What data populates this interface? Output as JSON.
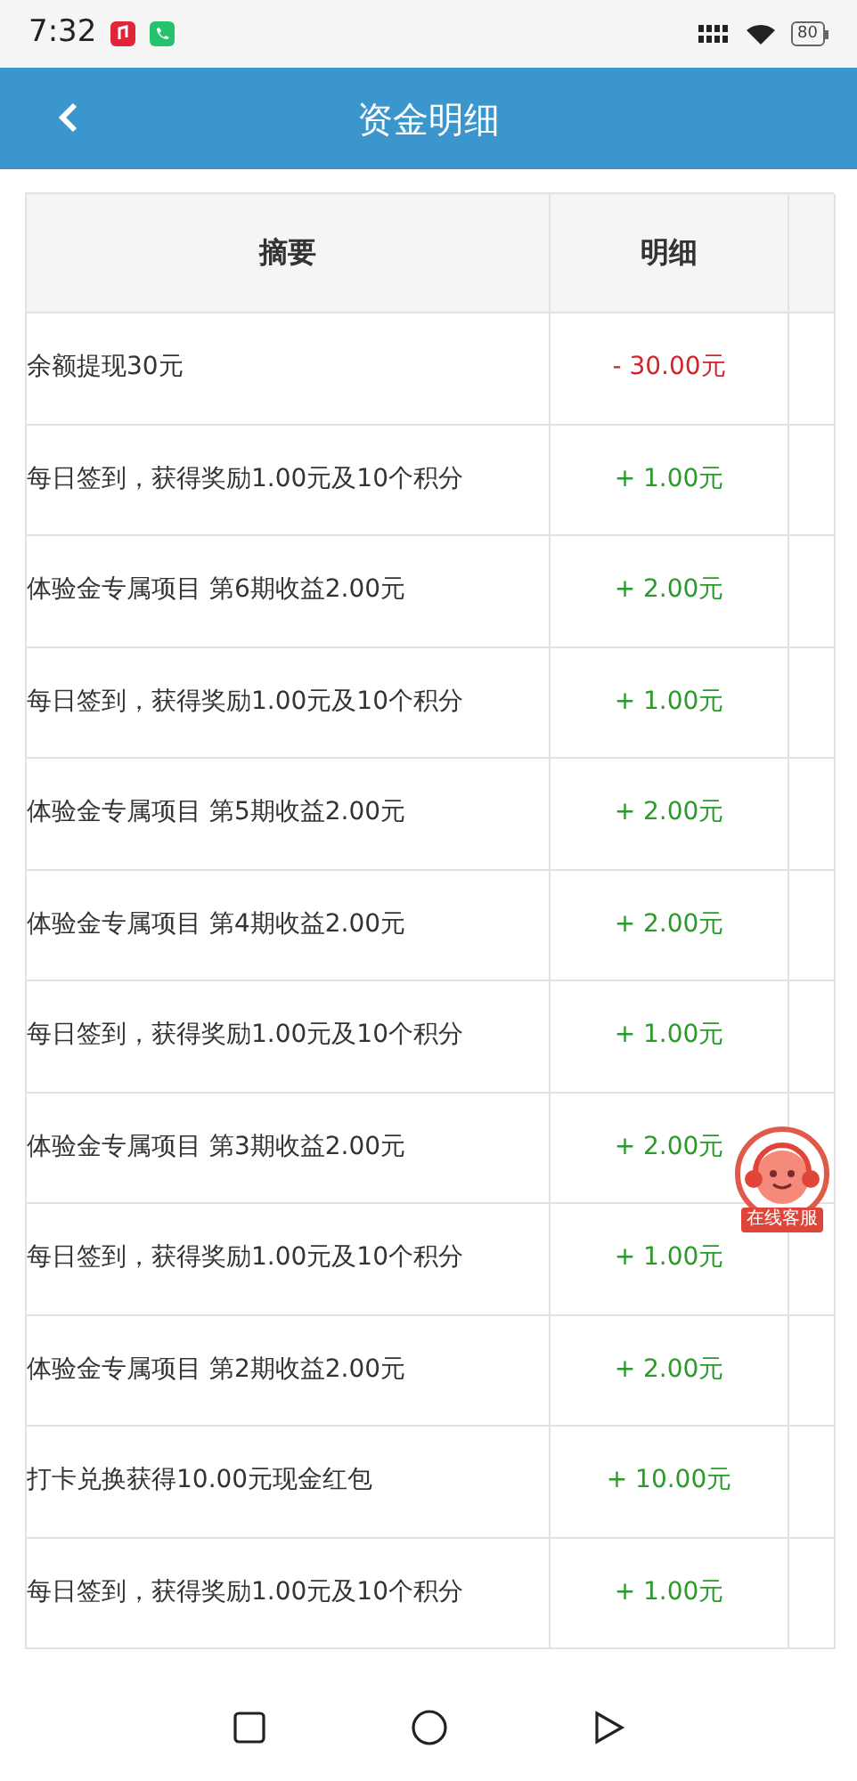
{
  "status_bar": {
    "time": "7:32",
    "battery": "80"
  },
  "header": {
    "title": "资金明细"
  },
  "table": {
    "columns": [
      "摘要",
      "明细"
    ],
    "rows": [
      {
        "summary": "余额提现30元",
        "amount": "- 30.00元",
        "kind": "debit"
      },
      {
        "summary": "每日签到，获得奖励1.00元及10个积分",
        "amount": "+ 1.00元",
        "kind": "credit"
      },
      {
        "summary": "体验金专属项目 第6期收益2.00元",
        "amount": "+ 2.00元",
        "kind": "credit"
      },
      {
        "summary": "每日签到，获得奖励1.00元及10个积分",
        "amount": "+ 1.00元",
        "kind": "credit"
      },
      {
        "summary": "体验金专属项目 第5期收益2.00元",
        "amount": "+ 2.00元",
        "kind": "credit"
      },
      {
        "summary": "体验金专属项目 第4期收益2.00元",
        "amount": "+ 2.00元",
        "kind": "credit"
      },
      {
        "summary": "每日签到，获得奖励1.00元及10个积分",
        "amount": "+ 1.00元",
        "kind": "credit"
      },
      {
        "summary": "体验金专属项目 第3期收益2.00元",
        "amount": "+ 2.00元",
        "kind": "credit"
      },
      {
        "summary": "每日签到，获得奖励1.00元及10个积分",
        "amount": "+ 1.00元",
        "kind": "credit"
      },
      {
        "summary": "体验金专属项目 第2期收益2.00元",
        "amount": "+ 2.00元",
        "kind": "credit"
      },
      {
        "summary": "打卡兑换获得10.00元现金红包",
        "amount": "+ 10.00元",
        "kind": "credit"
      },
      {
        "summary": "每日签到，获得奖励1.00元及10个积分",
        "amount": "+ 1.00元",
        "kind": "credit"
      }
    ]
  },
  "support_badge": {
    "label": "在线客服"
  }
}
